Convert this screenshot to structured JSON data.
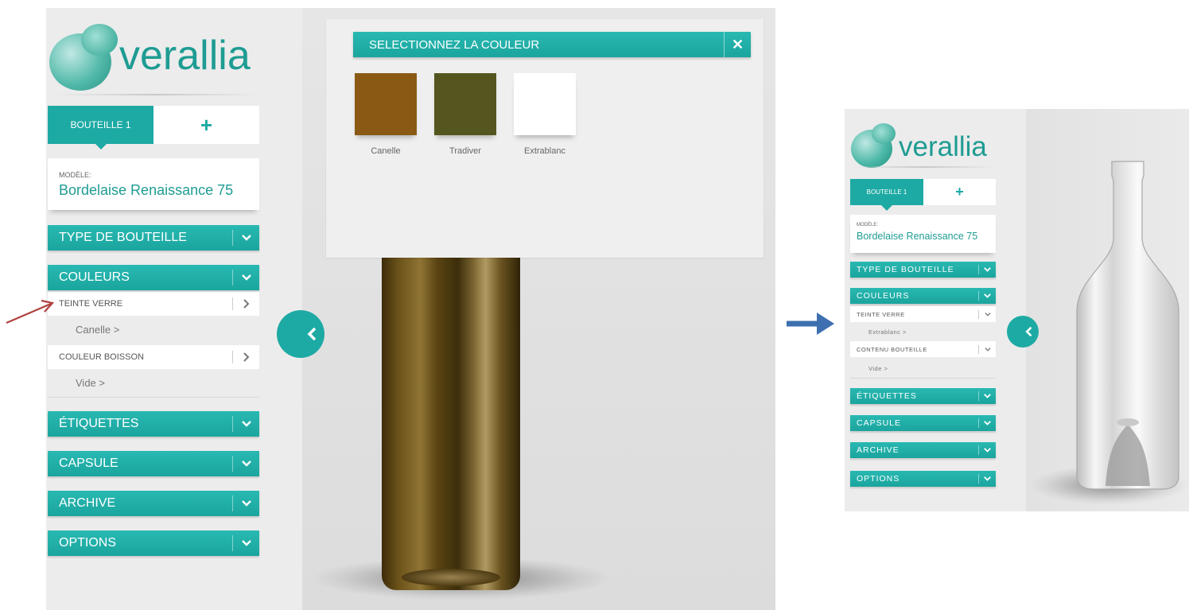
{
  "left": {
    "logo": "verallia",
    "tabs": {
      "active": "BOUTEILLE 1",
      "add": "+"
    },
    "model": {
      "label": "MODÈLE:",
      "value": "Bordelaise Renaissance 75"
    },
    "menu": {
      "type_bouteille": "TYPE DE BOUTEILLE",
      "couleurs": "COULEURS",
      "teinte_verre": "TEINTE VERRE",
      "teinte_value": "Canelle  >",
      "couleur_boisson": "COULEUR BOISSON",
      "boisson_value": "Vide  >",
      "etiquettes": "ÉTIQUETTES",
      "capsule": "CAPSULE",
      "archive": "ARCHIVE",
      "options": "OPTIONS"
    },
    "popup": {
      "title": "SELECTIONNEZ LA COULEUR",
      "close": "✕",
      "swatches": [
        {
          "name": "Canelle",
          "color": "#8a5a14"
        },
        {
          "name": "Tradiver",
          "color": "#55561f"
        },
        {
          "name": "Extrablanc",
          "color": "#ffffff"
        }
      ]
    }
  },
  "right": {
    "logo": "verallia",
    "tabs": {
      "active": "BOUTEILLE 1",
      "add": "+"
    },
    "model": {
      "label": "MODÈLE:",
      "value": "Bordelaise Renaissance 75"
    },
    "menu": {
      "type_bouteille": "TYPE DE BOUTEILLE",
      "couleurs": "COULEURS",
      "teinte_verre": "TEINTE VERRE",
      "teinte_value": "Extrablanc  >",
      "contenu_bouteille": "CONTENU BOUTEILLE",
      "contenu_value": "Vide  >",
      "etiquettes": "ÉTIQUETTES",
      "capsule": "CAPSULE",
      "archive": "ARCHIVE",
      "options": "OPTIONS"
    }
  },
  "colors": {
    "teal": "#1eaaa4",
    "logo_teal": "#1e9c93",
    "red_arrow": "#b0413e",
    "blue_arrow": "#3e6fb0"
  }
}
